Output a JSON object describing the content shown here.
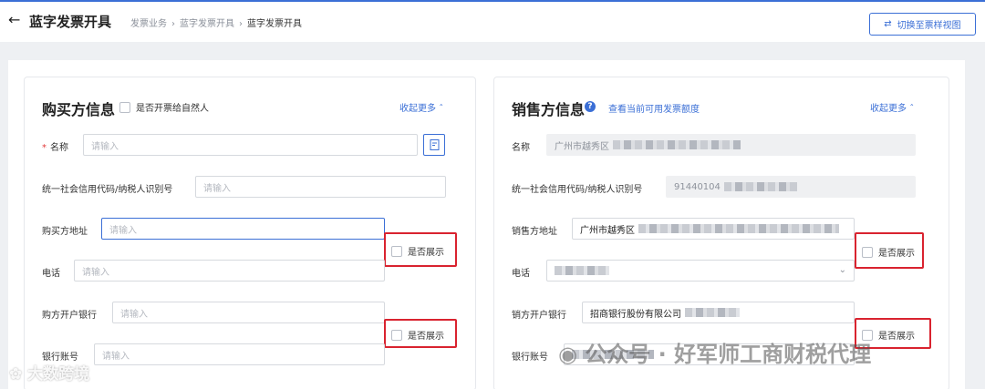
{
  "header": {
    "back_icon": "arrow-left-icon",
    "title": "蓝字发票开具",
    "breadcrumb": [
      "发票业务",
      "蓝字发票开具",
      "蓝字发票开具"
    ],
    "switch_label": "切换至票样视图"
  },
  "buyer": {
    "title": "购买方信息",
    "natural_person_label": "是否开票给自然人",
    "collapse_label": "收起更多",
    "name_label": "名称",
    "name_placeholder": "请输入",
    "taxid_label": "统一社会信用代码/纳税人识别号",
    "taxid_placeholder": "请输入",
    "address_label": "购买方地址",
    "address_placeholder": "请输入",
    "phone_label": "电话",
    "phone_placeholder": "请输入",
    "bank_label": "购方开户银行",
    "bank_placeholder": "请输入",
    "account_label": "银行账号",
    "account_placeholder": "请输入",
    "show_label_1": "是否展示",
    "show_label_2": "是否展示"
  },
  "seller": {
    "title": "销售方信息",
    "quota_link": "查看当前可用发票额度",
    "collapse_label": "收起更多",
    "name_label": "名称",
    "name_value": "广州市越秀区",
    "taxid_label": "统一社会信用代码/纳税人识别号",
    "taxid_value": "91440104",
    "address_label": "销售方地址",
    "address_value": "广州市越秀区",
    "phone_label": "电话",
    "bank_label": "销方开户银行",
    "bank_value": "招商银行股份有限公司",
    "account_label": "银行账号",
    "show_label_1": "是否展示",
    "show_label_2": "是否展示"
  },
  "watermarks": {
    "center": "公众号 · 好军师工商财税代理",
    "left": "大数跨境"
  },
  "colors": {
    "accent": "#3b6fd6",
    "highlight_box": "#d9232f",
    "required": "#e23b3b"
  }
}
